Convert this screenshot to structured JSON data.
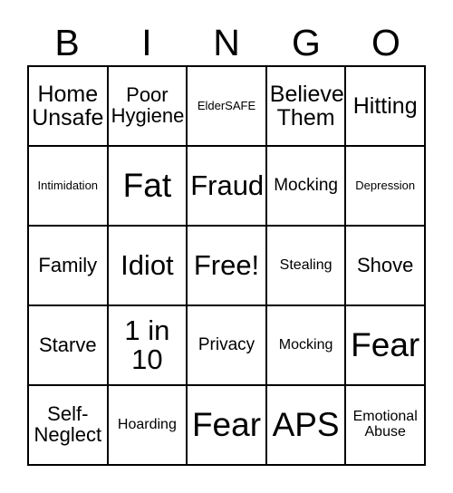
{
  "card": {
    "header_letters": [
      "B",
      "I",
      "N",
      "G",
      "O"
    ],
    "free_space_label": "Free!",
    "colors": {
      "background": "#ffffff",
      "border": "#000000",
      "text": "#000000"
    },
    "rows": [
      [
        {
          "text": "Home Unsafe",
          "size": "l"
        },
        {
          "text": "Poor Hygiene",
          "size": "ml"
        },
        {
          "text": "ElderSAFE",
          "size": "xs"
        },
        {
          "text": "Believe Them",
          "size": "l"
        },
        {
          "text": "Hitting",
          "size": "l"
        }
      ],
      [
        {
          "text": "Intimidation",
          "size": "xs"
        },
        {
          "text": "Fat",
          "size": "xxl"
        },
        {
          "text": "Fraud",
          "size": "xl"
        },
        {
          "text": "Mocking",
          "size": "m"
        },
        {
          "text": "Depression",
          "size": "xs"
        }
      ],
      [
        {
          "text": "Family",
          "size": "ml"
        },
        {
          "text": "Idiot",
          "size": "xl"
        },
        {
          "text": "Free!",
          "size": "xl"
        },
        {
          "text": "Stealing",
          "size": "s"
        },
        {
          "text": "Shove",
          "size": "ml"
        }
      ],
      [
        {
          "text": "Starve",
          "size": "ml"
        },
        {
          "text": "1 in 10",
          "size": "xl"
        },
        {
          "text": "Privacy",
          "size": "m"
        },
        {
          "text": "Mocking",
          "size": "s"
        },
        {
          "text": "Fear",
          "size": "xxl"
        }
      ],
      [
        {
          "text": "Self-Neglect",
          "size": "ml"
        },
        {
          "text": "Hoarding",
          "size": "s"
        },
        {
          "text": "Fear",
          "size": "xxl"
        },
        {
          "text": "APS",
          "size": "xxl"
        },
        {
          "text": "Emotional Abuse",
          "size": "s"
        }
      ]
    ]
  }
}
